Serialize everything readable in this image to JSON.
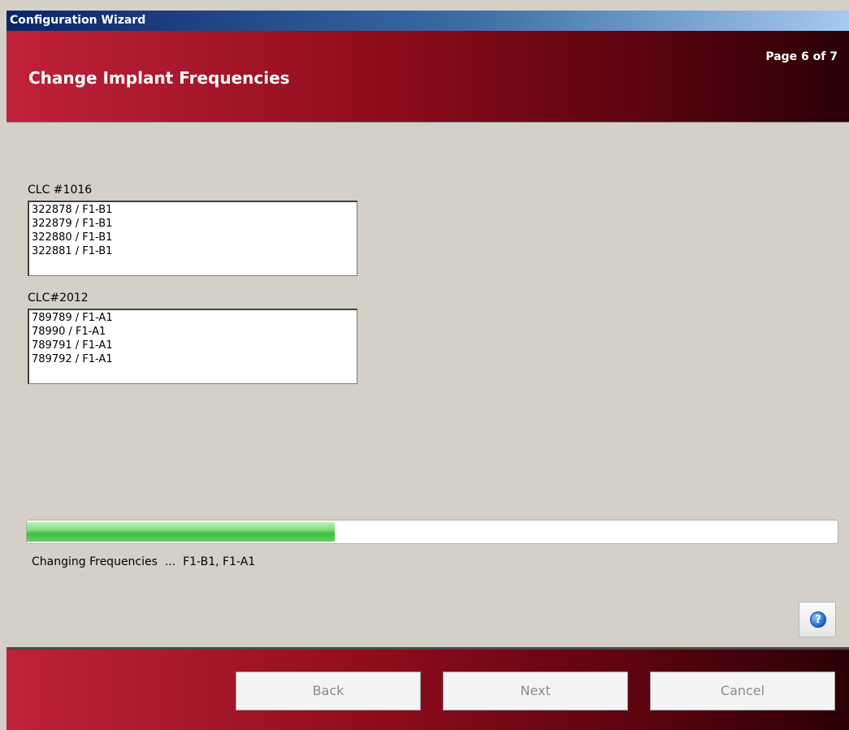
{
  "window": {
    "title": "Configuration Wizard"
  },
  "header": {
    "title": "Change Implant Frequencies",
    "page_indicator": "Page 6 of 7"
  },
  "groups": [
    {
      "label": "CLC #1016",
      "items": [
        "322878 / F1-B1",
        "322879 / F1-B1",
        "322880 / F1-B1",
        "322881 / F1-B1"
      ]
    },
    {
      "label": "CLC#2012",
      "items": [
        "789789 / F1-A1",
        "78990 / F1-A1",
        "789791 / F1-A1",
        "789792 / F1-A1"
      ]
    }
  ],
  "progress": {
    "value_percent": 38
  },
  "status_text": "Changing Frequencies  ...  F1-B1, F1-A1",
  "footer": {
    "back_label": "Back",
    "next_label": "Next",
    "cancel_label": "Cancel"
  },
  "icons": {
    "help": "help-question-icon"
  },
  "colors": {
    "accent_red": "#8e0c1c",
    "title_blue": "#0a246a",
    "progress_green": "#3cbf3c"
  }
}
